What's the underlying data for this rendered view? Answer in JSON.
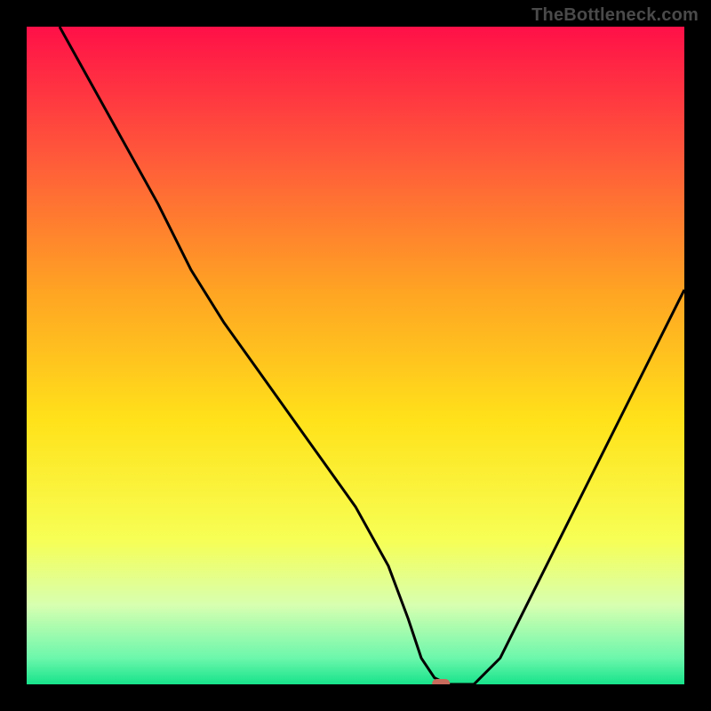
{
  "watermark": "TheBottleneck.com",
  "chart_data": {
    "type": "line",
    "title": "",
    "xlabel": "",
    "ylabel": "",
    "xlim": [
      0,
      100
    ],
    "ylim": [
      0,
      100
    ],
    "grid": false,
    "legend": false,
    "background_gradient": {
      "stops": [
        {
          "offset": 0.0,
          "color": "#ff1048"
        },
        {
          "offset": 0.2,
          "color": "#ff5a3a"
        },
        {
          "offset": 0.4,
          "color": "#ffa323"
        },
        {
          "offset": 0.6,
          "color": "#ffe21a"
        },
        {
          "offset": 0.78,
          "color": "#f7ff55"
        },
        {
          "offset": 0.88,
          "color": "#d7ffb0"
        },
        {
          "offset": 0.96,
          "color": "#6cf7ac"
        },
        {
          "offset": 1.0,
          "color": "#17e38a"
        }
      ]
    },
    "series": [
      {
        "name": "bottleneck-curve",
        "color": "#000000",
        "x": [
          5,
          10,
          15,
          20,
          25,
          30,
          35,
          40,
          45,
          50,
          55,
          58,
          60,
          62,
          64,
          68,
          72,
          76,
          80,
          85,
          90,
          95,
          100
        ],
        "y": [
          100,
          91,
          82,
          73,
          63,
          55,
          48,
          41,
          34,
          27,
          18,
          10,
          4,
          1,
          0,
          0,
          4,
          12,
          20,
          30,
          40,
          50,
          60
        ]
      }
    ],
    "marker": {
      "name": "optimal-point",
      "x": 63,
      "y": 0,
      "color": "#c86a5c",
      "shape": "rounded-rect"
    }
  }
}
